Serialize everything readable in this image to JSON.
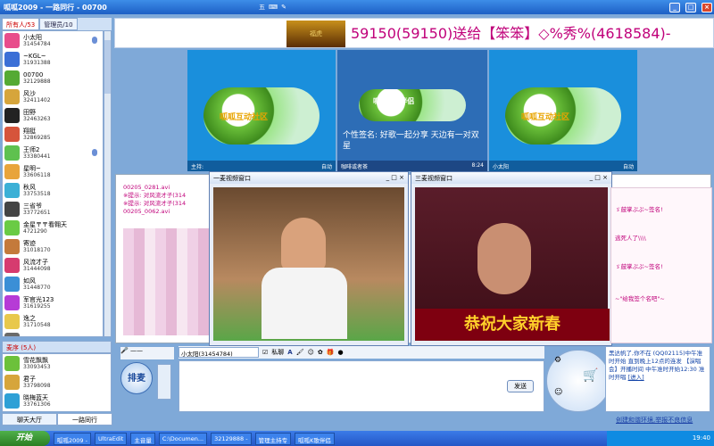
{
  "window": {
    "title": "呱呱2009 - 一路同行 - 00700"
  },
  "toolbar": {
    "label": "五"
  },
  "sidebar": {
    "tabs": [
      "所有人/53",
      "管理员/10"
    ],
    "users": [
      {
        "name": "小太阳",
        "id": "31454784",
        "color": "#e84c8b"
      },
      {
        "name": "~KGL~",
        "id": "31931388",
        "color": "#3b6fd6"
      },
      {
        "name": "00700",
        "id": "32129888",
        "color": "#55aa33"
      },
      {
        "name": "风沙",
        "id": "32411402",
        "color": "#d6a53b"
      },
      {
        "name": "田野",
        "id": "32463263",
        "color": "#222"
      },
      {
        "name": "翔挺",
        "id": "32869285",
        "color": "#d6543b"
      },
      {
        "name": "王师2",
        "id": "33380441",
        "color": "#5fc14f"
      },
      {
        "name": "星明~",
        "id": "33606118",
        "color": "#e8a43b"
      },
      {
        "name": "秋风",
        "id": "33753518",
        "color": "#3bb0d6"
      },
      {
        "name": "三省爷",
        "id": "33772651",
        "color": "#444"
      },
      {
        "name": "金星〒〒看翱天",
        "id": "4721290",
        "color": "#6acb44"
      },
      {
        "name": "寄迹",
        "id": "31018170",
        "color": "#c47a3b"
      },
      {
        "name": "风流才子",
        "id": "31444098",
        "color": "#d63b6f"
      },
      {
        "name": "如风",
        "id": "31448770",
        "color": "#3b8fd6"
      },
      {
        "name": "军官光123",
        "id": "31619255",
        "color": "#b63bd6"
      },
      {
        "name": "逸之",
        "id": "31710548",
        "color": "#e8c84c"
      },
      {
        "name": "千帆",
        "id": "",
        "color": "#6a6a6a"
      }
    ],
    "queue_label": "麦序 (5人)",
    "queue": [
      {
        "name": "雪花飘飘",
        "id": "33093453",
        "color": "#6cc13b"
      },
      {
        "name": "君子",
        "id": "33798098",
        "color": "#d6a53b"
      },
      {
        "name": "晓梅蓝天",
        "id": "33761306",
        "color": "#2ea0d6"
      }
    ],
    "bottom_tabs": [
      "聊天大厅",
      "一路同行"
    ]
  },
  "banner": {
    "tiger_label": "福虎",
    "text": "59150(59150)送给【笨笨】◇%秀%(4618584)-"
  },
  "videos": [
    {
      "logo": "呱呱互动社区",
      "left": "主持:",
      "right": "自动"
    },
    {
      "logo": "呱呱K歌伴侣",
      "sign": "个性签名: 好歌一起分享 天边有一对双星",
      "left": "咖啡或者茶",
      "right": "8:24"
    },
    {
      "logo": "呱呱互动社区",
      "left": "小太阳",
      "right": "自动"
    }
  ],
  "chat": {
    "lines": [
      "00205_0281.avi",
      "※提示: 对风流才子(314",
      "※提示: 对风流才子(314",
      "00205_0062.avi"
    ],
    "mic1_title": "一麦视频窗口",
    "mic2_title": "三麦视频窗口",
    "mic2_caption": "恭祝大家新春",
    "right_lines": [
      "ゞ鼓掌ぷぷ~签名!",
      "逃死人了\\\\\\\\",
      "ゞ鼓掌ぷぷ~签名!",
      "~\"给我签个名吧\"~"
    ]
  },
  "input": {
    "target": "小太阳(31454784)",
    "private_label": "私聊",
    "pai_mai": "排麦",
    "send": "发送"
  },
  "notice": {
    "text": "黑达帆了,你不在 (QQ02115)中午准时开始 直到晚上12点的连发 【演唱会】开播时间 中午准时开始12:30 准时开唱",
    "link": "[进入]"
  },
  "status_link": "创建和谐环境,举报不良信息",
  "taskbar": {
    "start": "开始",
    "tasks": [
      "呱呱2009 -",
      "UltraEdit",
      "主音量",
      "C:\\Documen...",
      "32129888 -",
      "管理主持专",
      "呱呱K歌伴侣"
    ],
    "clock": "19:40"
  }
}
